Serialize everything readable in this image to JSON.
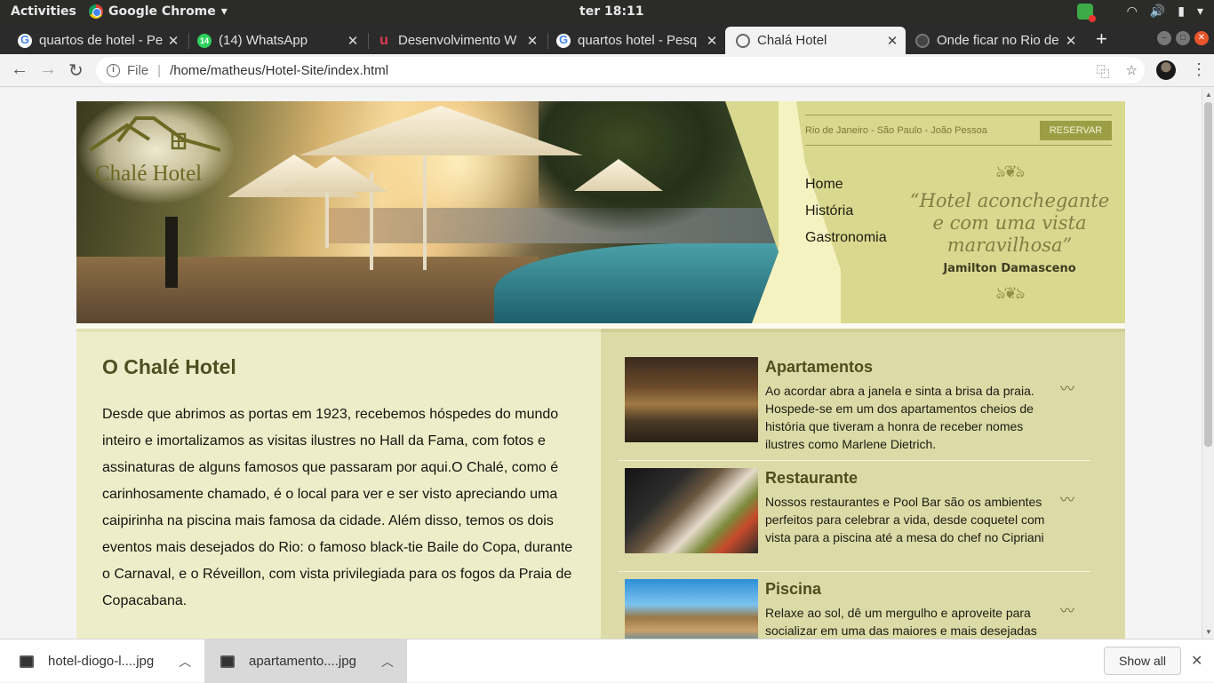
{
  "system_bar": {
    "activities": "Activities",
    "app_name": "Google Chrome",
    "clock": "ter 18:11"
  },
  "tabs": [
    {
      "title": "quartos de hotel - Pe",
      "icon": "google-icon"
    },
    {
      "title": "(14) WhatsApp",
      "icon": "whatsapp-icon",
      "badge": "14"
    },
    {
      "title": "Desenvolvimento W",
      "icon": "udemy-icon"
    },
    {
      "title": "quartos hotel - Pesq",
      "icon": "google-icon"
    },
    {
      "title": "Chalá Hotel",
      "icon": "globe-icon",
      "active": true
    },
    {
      "title": "Onde ficar no Rio de",
      "icon": "loading-icon"
    }
  ],
  "toolbar": {
    "file_label": "File",
    "url": "/home/matheus/Hotel-Site/index.html"
  },
  "site": {
    "logo_text": "Chalé Hotel",
    "locations": "Rio de Janeiro - São Paulo - João Pessoa",
    "reserve": "RESERVAR",
    "nav": [
      "Home",
      "História",
      "Gastronomia"
    ],
    "quote": "“Hotel aconchegante e com uma vista maravilhosa”",
    "quote_author": "Jamilton Damasceno",
    "about_title": "O Chalé Hotel",
    "about_text": "Desde que abrimos as portas em 1923, recebemos hóspedes do mundo inteiro e imortalizamos as visitas ilustres no Hall da Fama, com fotos e assinaturas de alguns famosos que passaram por aqui.O Chalé, como é carinhosamente chamado, é o local para ver e ser visto apreciando uma caipirinha na piscina mais famosa da cidade. Além disso, temos os dois eventos mais desejados do Rio: o famoso black-tie Baile do Copa, durante o Carnaval, e o Réveillon, com vista privilegiada para os fogos da Praia de Copacabana.",
    "features": [
      {
        "title": "Apartamentos",
        "text": "Ao acordar abra a janela e sinta a brisa da praia. Hospede-se em um dos apartamentos cheios de história que tiveram a honra de receber nomes ilustres como Marlene Dietrich."
      },
      {
        "title": "Restaurante",
        "text": "Nossos restaurantes e Pool Bar são os ambientes perfeitos para celebrar a vida, desde coquetel com vista para a piscina até a mesa do chef no Cipriani"
      },
      {
        "title": "Piscina",
        "text": "Relaxe ao sol, dê um mergulho e aproveite para socializar em uma das maiores e mais desejadas"
      }
    ]
  },
  "downloads": {
    "items": [
      "hotel-diogo-l....jpg",
      "apartamento....jpg"
    ],
    "show_all": "Show all"
  },
  "colors": {
    "header_bg": "#d9d88f",
    "accent_olive": "#9b9e45",
    "left_col_bg": "#edeec9",
    "right_col_bg": "#dcdba7"
  }
}
